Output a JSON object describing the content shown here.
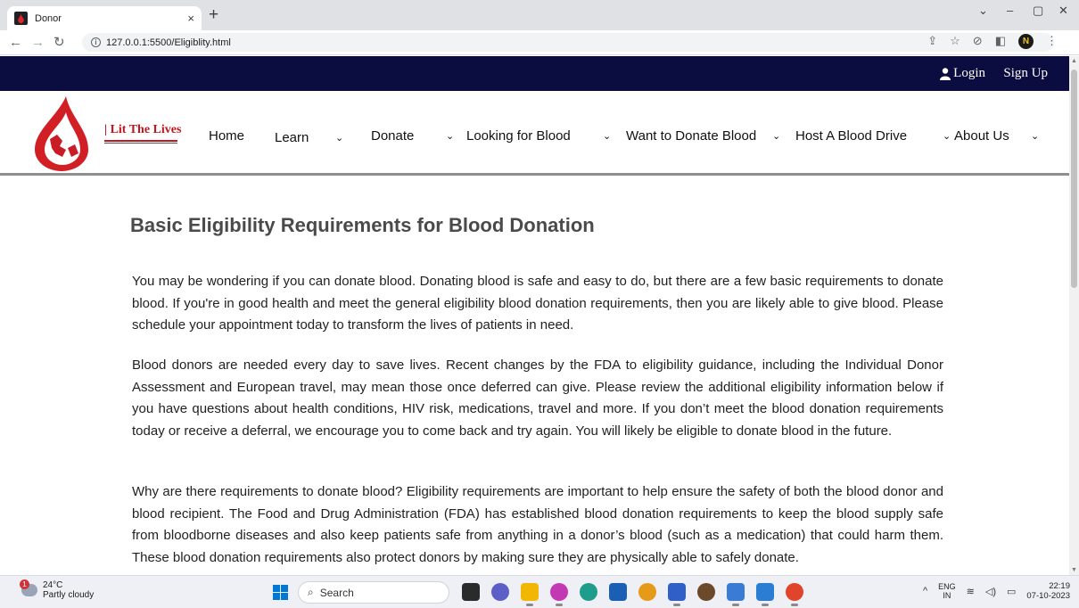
{
  "browser": {
    "tab_title": "Donor",
    "tab_close": "×",
    "new_tab": "+",
    "url": "127.0.0.1:5500/Eligiblity.html",
    "window_controls": [
      "⌄",
      "–",
      "▢",
      "✕"
    ]
  },
  "topbar": {
    "login_label": "Login",
    "signup_label": "Sign Up"
  },
  "brand": {
    "name": "| Lit The Lives"
  },
  "nav": {
    "items": [
      {
        "label": "Home",
        "has_dropdown": false
      },
      {
        "label": "Learn",
        "has_dropdown": true
      },
      {
        "label": "Donate",
        "has_dropdown": true
      },
      {
        "label": "Looking for Blood",
        "has_dropdown": true
      },
      {
        "label": "Want to Donate Blood",
        "has_dropdown": true
      },
      {
        "label": "Host A Blood Drive",
        "has_dropdown": false
      },
      {
        "label": "About Us",
        "has_dropdown": true
      }
    ]
  },
  "main": {
    "heading": "Basic Eligibility Requirements for Blood Donation",
    "paragraphs": [
      "You may be wondering if you can donate blood. Donating blood is safe and easy to do, but there are a few basic requirements to donate blood. If you're in good health and meet the general eligibility blood donation requirements, then you are likely able to give blood. Please schedule your appointment today to transform the lives of patients in need.",
      "Blood donors are needed every day to save lives. Recent changes by the FDA to eligibility guidance, including the Individual Donor Assessment and European travel, may mean those once deferred can give. Please review the additional eligibility information below if you have questions about health conditions, HIV risk, medications, travel and more. If you don’t meet the blood donation requirements today or receive a deferral, we encourage you to come back and try again. You will likely be eligible to donate blood in the future.",
      "Why are there requirements to donate blood? Eligibility requirements are important to help ensure the safety of both the blood donor and blood recipient. The Food and Drug Administration (FDA) has established blood donation requirements to keep the blood supply safe from bloodborne diseases and also keep patients safe from anything in a donor’s blood (such as a medication) that could harm them. These blood donation requirements also protect donors by making sure they are physically able to safely donate."
    ]
  },
  "taskbar": {
    "weather_temp": "24°C",
    "weather_desc": "Partly cloudy",
    "weather_badge": "1",
    "search_label": "Search",
    "lang_top": "ENG",
    "lang_bottom": "IN",
    "time": "22:19",
    "date": "07-10-2023"
  },
  "colors": {
    "topbar": "#0b0c3f",
    "brand_red": "#c0161d",
    "heading": "#4a4a4a"
  }
}
